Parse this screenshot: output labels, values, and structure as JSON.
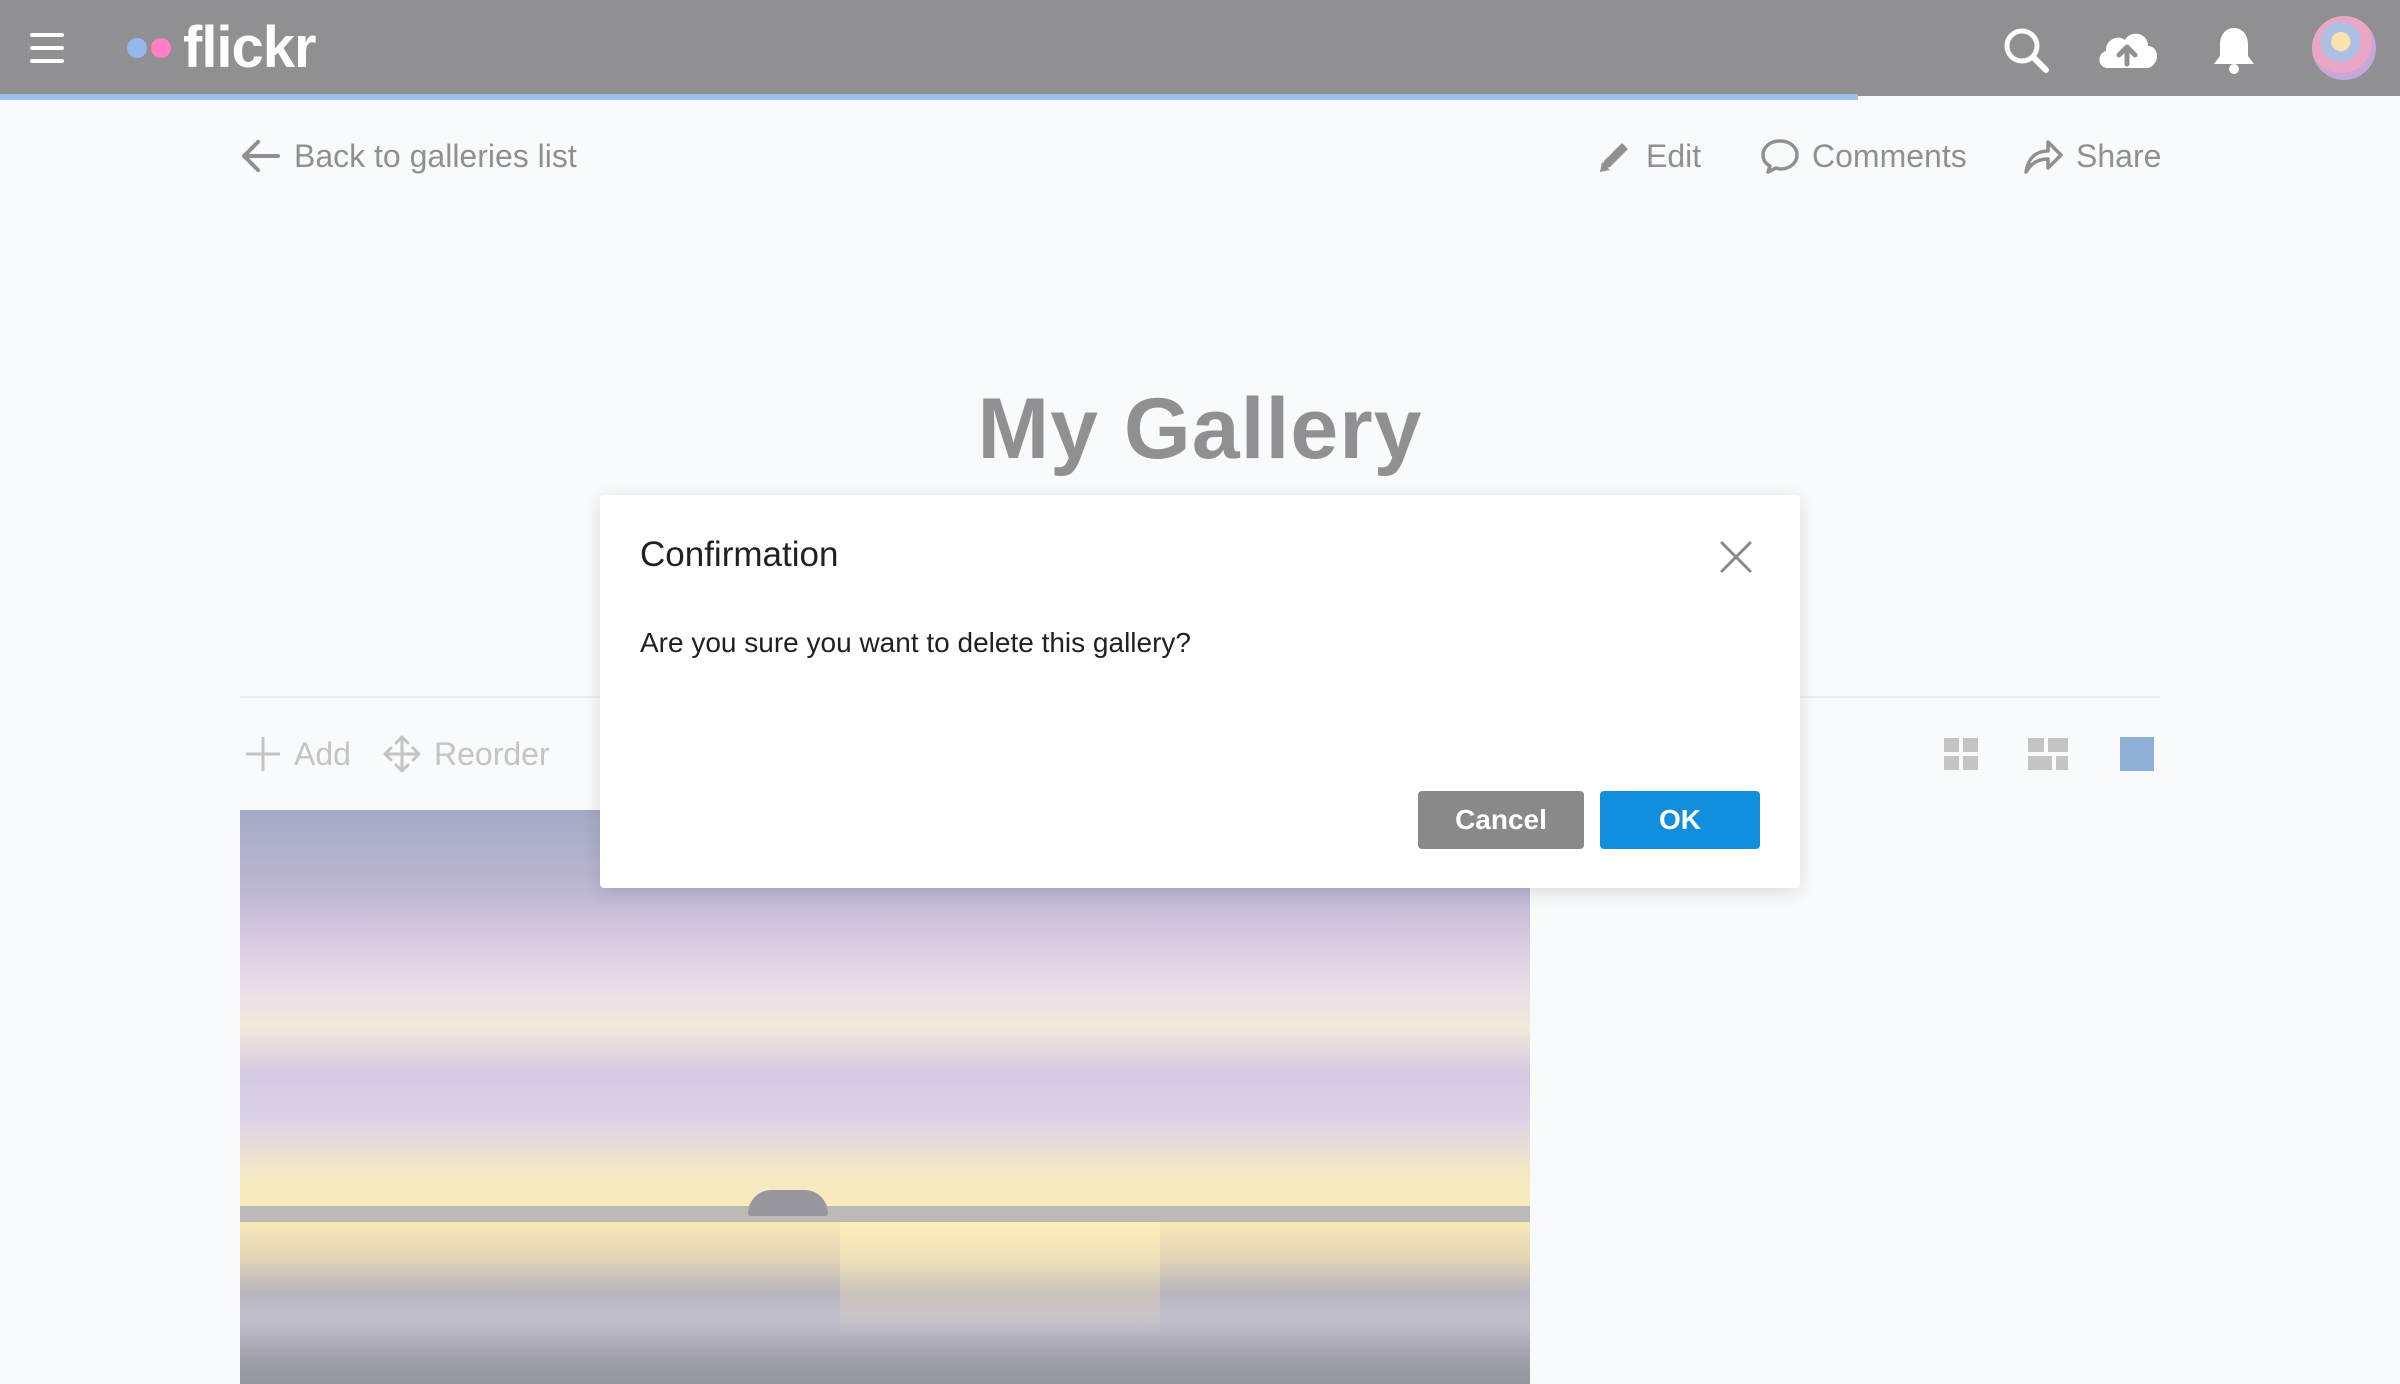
{
  "header": {
    "brand": "flickr",
    "icons": [
      "menu-icon",
      "search-icon",
      "upload-cloud-icon",
      "bell-icon"
    ],
    "colors": {
      "bar": "#212124",
      "progress": "#3a7fd0",
      "dot_blue": "#2d6fd6",
      "dot_pink": "#ff0084"
    }
  },
  "subnav": {
    "back_label": "Back to galleries list",
    "edit_label": "Edit",
    "comments_label": "Comments",
    "share_label": "Share"
  },
  "gallery": {
    "title": "My Gallery"
  },
  "toolbar": {
    "add_label": "Add",
    "reorder_label": "Reorder",
    "view_modes": [
      "grid-view-icon",
      "justified-view-icon",
      "single-view-icon"
    ],
    "active_view": "single-view-icon"
  },
  "dialog": {
    "title": "Confirmation",
    "message": "Are you sure you want to delete this gallery?",
    "cancel_label": "Cancel",
    "ok_label": "OK",
    "colors": {
      "ok": "#128fdc",
      "cancel": "#898989"
    }
  }
}
